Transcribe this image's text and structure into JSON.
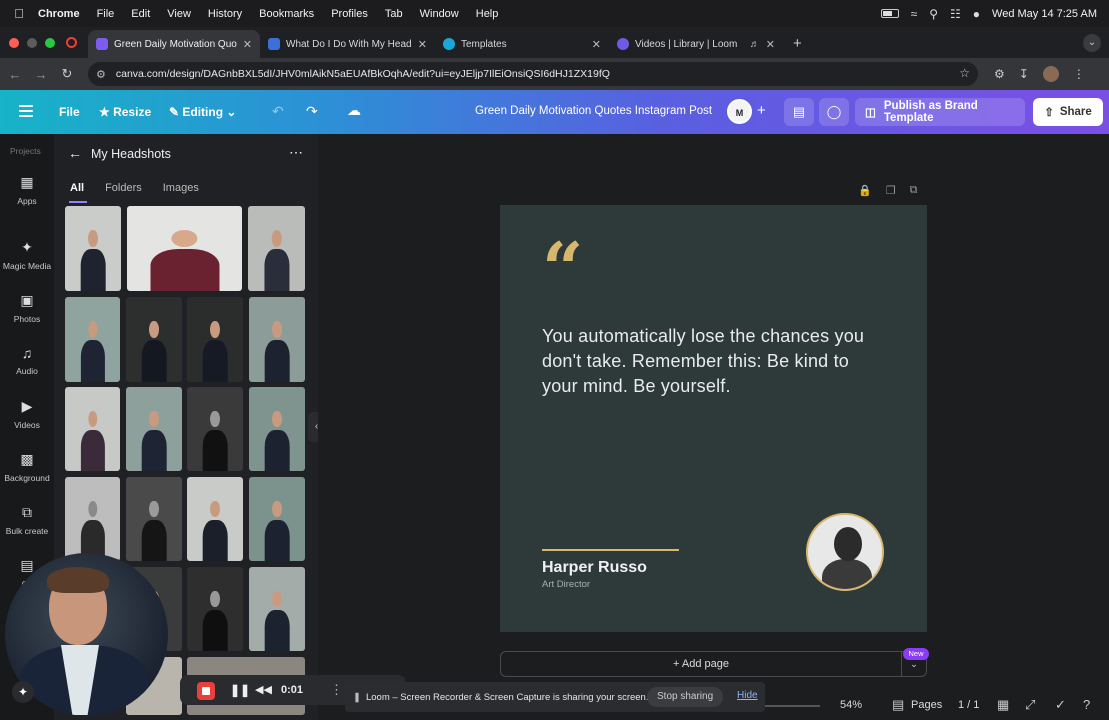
{
  "menubar": {
    "app": "Chrome",
    "items": [
      "File",
      "Edit",
      "View",
      "History",
      "Bookmarks",
      "Profiles",
      "Tab",
      "Window",
      "Help"
    ],
    "datetime": "Wed May 14  7:25 AM"
  },
  "browser": {
    "tabs": [
      {
        "title": "Green Daily Motivation Quote",
        "active": true
      },
      {
        "title": "What Do I Do With My Headsh",
        "active": false
      },
      {
        "title": "Templates",
        "active": false
      },
      {
        "title": "Videos | Library | Loom",
        "active": false
      }
    ],
    "url": "canva.com/design/DAGnbBXL5dI/JHV0mlAikN5aEUAfBkOqhA/edit?ui=eyJEljp7IlEiOnsiQSI6dHJ1ZX19fQ"
  },
  "canva_toolbar": {
    "file": "File",
    "resize": "Resize",
    "editing": "Editing",
    "design_title": "Green Daily Motivation Quotes Instagram Post",
    "avatar_initial": "M",
    "publish": "Publish as Brand Template",
    "share": "Share"
  },
  "rail": {
    "projects": "Projects",
    "items": [
      "Apps",
      "Magic Media",
      "Photos",
      "Audio",
      "Videos",
      "Background",
      "Bulk create",
      "Ch"
    ]
  },
  "panel": {
    "title": "My Headshots",
    "tabs": [
      "All",
      "Folders",
      "Images"
    ]
  },
  "design": {
    "quote_mark": "“",
    "quote": "You automatically lose the chances you don't take. Remember this: Be kind to your mind. Be yourself.",
    "author": "Harper Russo",
    "role": "Art Director",
    "colors": {
      "background": "#2e3a3a",
      "accent": "#d6b76e",
      "text": "#e8ecec"
    }
  },
  "page_controls": {
    "add_page": "+ Add page",
    "new_badge": "New",
    "zoom": "54%",
    "pages": "Pages",
    "page_num": "1 / 1"
  },
  "loom": {
    "time": "0:01",
    "share_message": "Loom – Screen Recorder & Screen Capture is sharing your screen.",
    "stop_sharing": "Stop sharing",
    "hide": "Hide"
  }
}
